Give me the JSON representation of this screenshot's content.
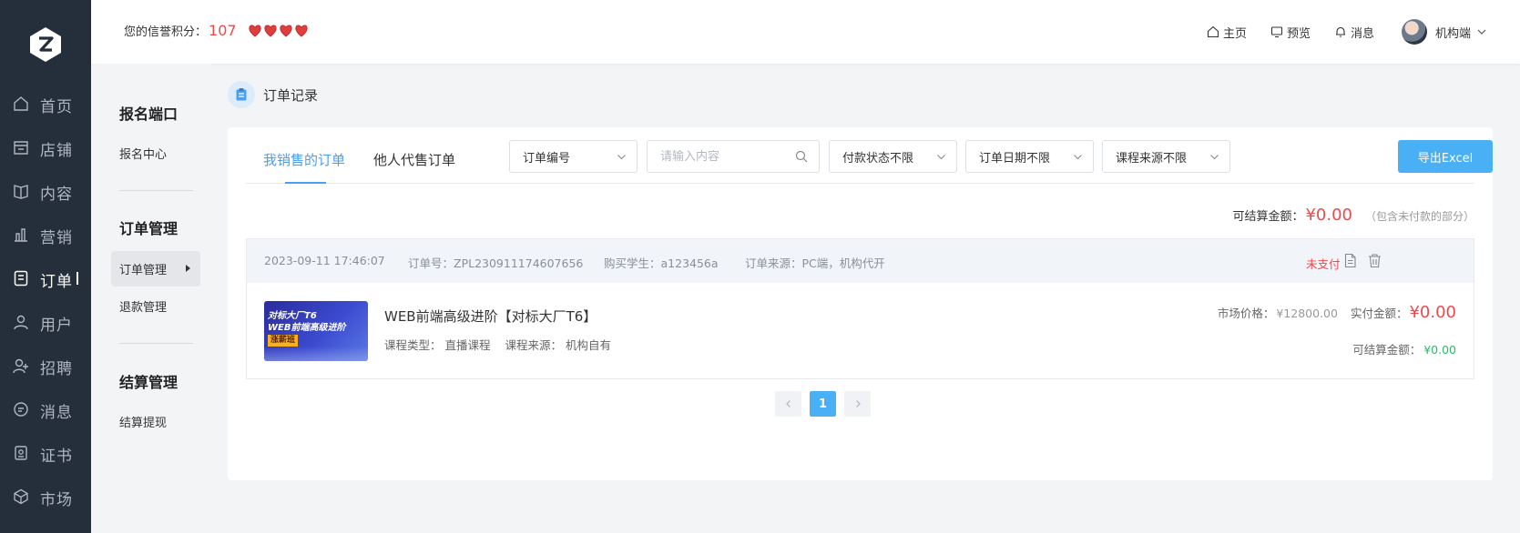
{
  "sidebar": {
    "items": [
      {
        "label": "首页",
        "icon": "home-icon"
      },
      {
        "label": "店铺",
        "icon": "store-icon"
      },
      {
        "label": "内容",
        "icon": "book-icon"
      },
      {
        "label": "营销",
        "icon": "bar-chart-icon"
      },
      {
        "label": "订单",
        "icon": "order-icon",
        "active": true
      },
      {
        "label": "用户",
        "icon": "user-icon"
      },
      {
        "label": "招聘",
        "icon": "recruit-icon"
      },
      {
        "label": "消息",
        "icon": "message-icon"
      },
      {
        "label": "证书",
        "icon": "certificate-icon"
      },
      {
        "label": "市场",
        "icon": "market-icon"
      }
    ]
  },
  "header": {
    "credit_label": "您的信誉积分：",
    "credit_score": "107",
    "hearts": 4,
    "links": {
      "home": "主页",
      "preview": "预览",
      "messages": "消息"
    },
    "user_name": "机构端"
  },
  "subnav": {
    "groups": [
      {
        "title": "报名端口",
        "items": [
          "报名中心"
        ]
      },
      {
        "title": "订单管理",
        "items": [
          "订单管理",
          "退款管理"
        ]
      },
      {
        "title": "结算管理",
        "items": [
          "结算提现"
        ]
      }
    ]
  },
  "page": {
    "title": "订单记录"
  },
  "tabs": {
    "mine": "我销售的订单",
    "agent": "他人代售订单"
  },
  "filters": {
    "order_field": "订单编号",
    "search_placeholder": "请输入内容",
    "pay_status": "付款状态不限",
    "order_date": "订单日期不限",
    "course_source": "课程来源不限",
    "export": "导出Excel"
  },
  "summary": {
    "label": "可结算金额：",
    "amount": "¥0.00",
    "note": "（包含未付款的部分）"
  },
  "order": {
    "time": "2023-09-11 17:46:07",
    "order_no": "订单号：ZPL230911174607656",
    "student": "购买学生：a123456a",
    "source": "订单来源：PC端，机构代开",
    "status": "未支付",
    "thumb_line1": "对标大厂T6",
    "thumb_line2": "WEB前端高级进阶",
    "thumb_badge": "涨薪班",
    "course_title": "WEB前端高级进阶【对标大厂T6】",
    "course_type_label": "课程类型：",
    "course_type": "直播课程",
    "course_source_label": "课程来源：",
    "course_source": "机构自有",
    "market_price_label": "市场价格：",
    "market_price": "¥12800.00",
    "paid_label": "实付金额：",
    "paid": "¥0.00",
    "settle_label": "可结算金额：",
    "settle": "¥0.00"
  },
  "pagination": {
    "current": "1"
  },
  "colors": {
    "rail_bg": "#252f3b",
    "accent": "#4a9ff0",
    "button": "#4ab0f5",
    "danger": "#ee4a4a",
    "success": "#2fb86a"
  }
}
